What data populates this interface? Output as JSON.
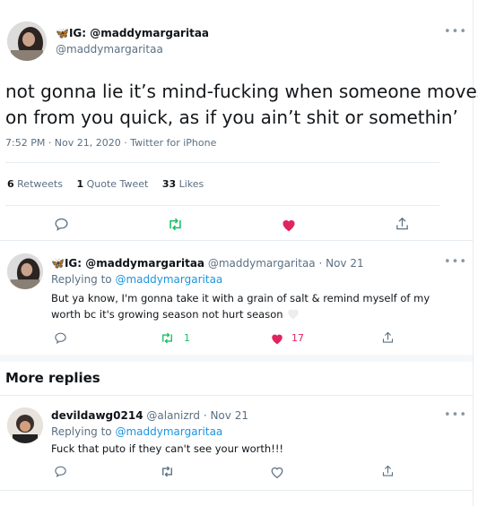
{
  "main_tweet": {
    "display_name": "IG: @maddymargaritaa",
    "handle": "@maddymargaritaa",
    "text_line1": "not gonna lie it’s mind-fucking when someone moves",
    "text_line2": "on from you quick, as if you ain’t shit or somethin’",
    "timestamp": "7:52 PM · Nov 21, 2020 · Twitter for iPhone",
    "stats": {
      "retweets_count": "6",
      "retweets_label": "Retweets",
      "quotes_count": "1",
      "quotes_label": "Quote Tweet",
      "likes_count": "33",
      "likes_label": "Likes"
    },
    "more_icon": "more-dots-icon"
  },
  "reply1": {
    "display_name": "IG: @maddymargaritaa",
    "handle": "@maddymargaritaa",
    "date": "· Nov 21",
    "replying_prefix": "Replying to",
    "replying_to": "@maddymargaritaa",
    "text_line1": "But ya know, I'm gonna take it with a grain of salt & remind myself of my",
    "text_line2": "worth bc it's growing season not hurt season",
    "retweet_count": "1",
    "like_count": "17"
  },
  "more_replies": {
    "heading": "More replies"
  },
  "reply2": {
    "display_name": "devildawg0214",
    "handle": "@alanizrd",
    "date": "· Nov 21",
    "replying_prefix": "Replying to",
    "replying_to": "@maddymargaritaa",
    "text": "Fuck that puto if they can't see your worth!!!"
  },
  "colors": {
    "accent": "#1b95e0",
    "retweet_green": "#17bf63",
    "like_red": "#e0245e",
    "muted": "#5b7083",
    "butterfly_blue": "#1d9bf0"
  }
}
